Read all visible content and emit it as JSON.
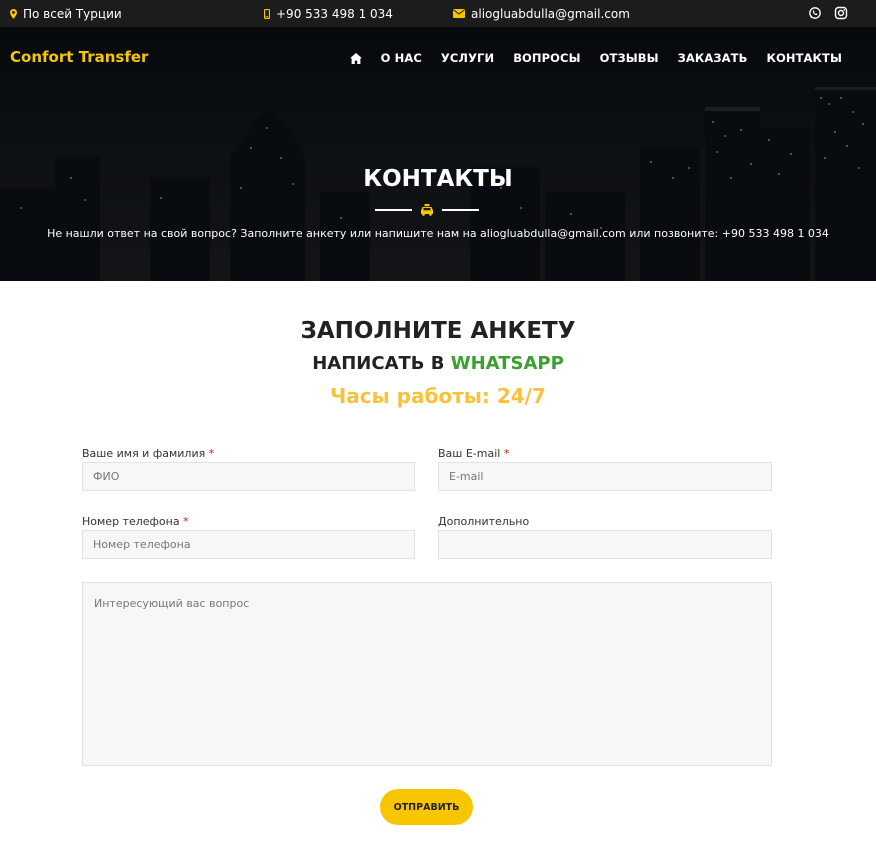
{
  "topbar": {
    "location": "По всей Турции",
    "phone": "+90 533 498 1 034",
    "email": "aliogluabdulla@gmail.com"
  },
  "brand": "Confort Transfer",
  "nav": [
    {
      "label": "О НАС"
    },
    {
      "label": "УСЛУГИ"
    },
    {
      "label": "ВОПРОСЫ"
    },
    {
      "label": "ОТЗЫВЫ"
    },
    {
      "label": "ЗАКАЗАТЬ"
    },
    {
      "label": "КОНТАКТЫ"
    }
  ],
  "hero": {
    "title": "КОНТАКТЫ",
    "subtitle": "Не нашли ответ на свой вопрос? Заполните анкету или напишите нам на aliogluabdulla@gmail.com или позвоните: +90 533 498 1 034"
  },
  "form_section": {
    "heading": "ЗАПОЛНИТЕ АНКЕТУ",
    "whatsapp_prefix": "НАПИСАТЬ В ",
    "whatsapp_link": "WHATSAPP",
    "hours": "Часы работы: 24/7"
  },
  "form": {
    "name_label": "Ваше имя и фамилия",
    "name_placeholder": "ФИО",
    "email_label": "Ваш E-mail",
    "email_placeholder": "E-mail",
    "phone_label": "Номер телефона",
    "phone_placeholder": "Номер телефона",
    "extra_label": "Дополнительно",
    "extra_placeholder": "",
    "question_placeholder": "Интересующий вас вопрос",
    "required_mark": "*",
    "submit_label": "ОТПРАВИТЬ"
  },
  "colors": {
    "accent": "#f7c600",
    "whatsapp": "#3aa02e",
    "hours": "#f7c23c",
    "topbar_bg": "#1c1c1c"
  },
  "icons": {
    "location": "map-marker-icon",
    "phone": "mobile-phone-icon",
    "email": "envelope-icon",
    "whatsapp": "whatsapp-icon",
    "instagram": "instagram-icon",
    "home": "home-icon",
    "divider": "taxi-car-icon"
  }
}
